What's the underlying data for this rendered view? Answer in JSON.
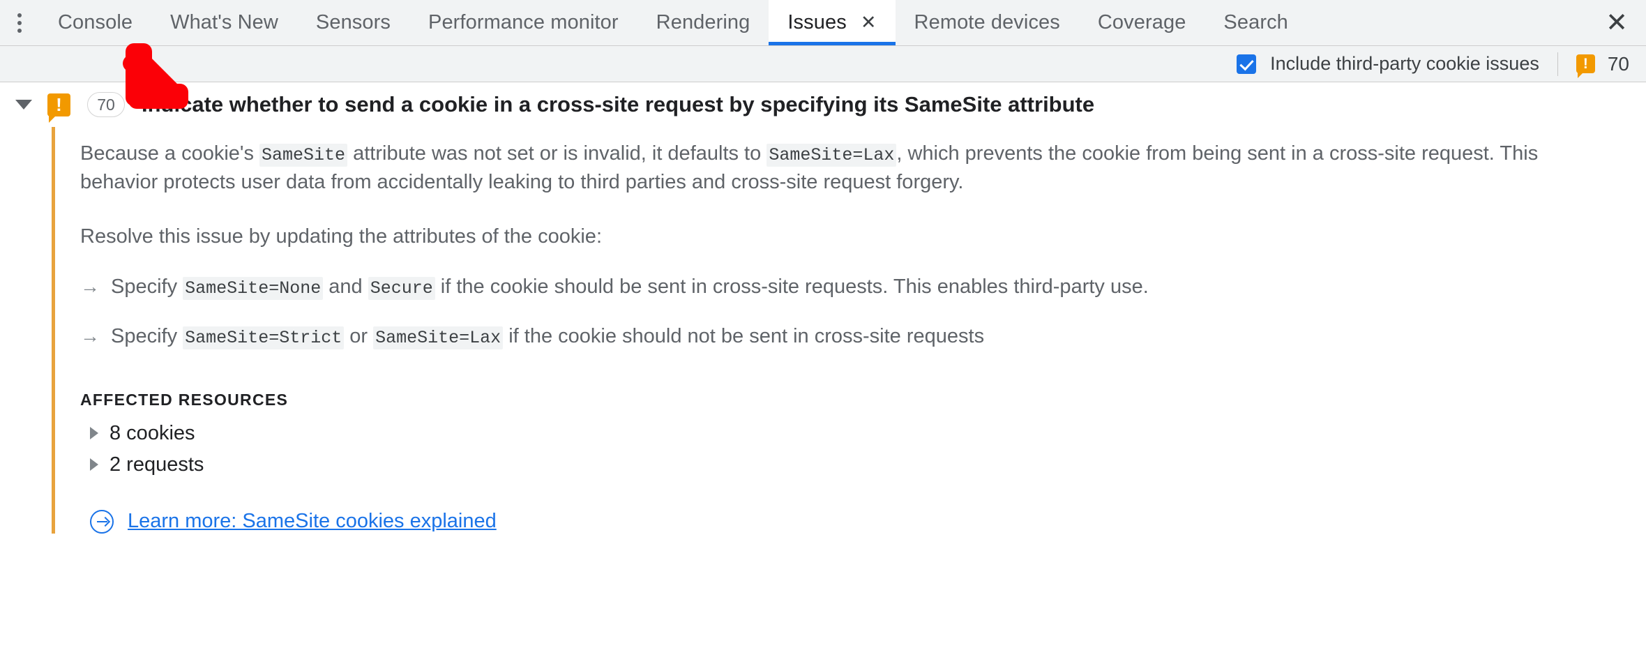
{
  "tabbar": {
    "menu_icon": "kebab-menu-icon",
    "close_icon": "close-icon",
    "close_glyph": "✕",
    "tab_close_glyph": "✕",
    "tabs": [
      {
        "label": "Console",
        "active": false
      },
      {
        "label": "What's New",
        "active": false
      },
      {
        "label": "Sensors",
        "active": false
      },
      {
        "label": "Performance monitor",
        "active": false
      },
      {
        "label": "Rendering",
        "active": false
      },
      {
        "label": "Issues",
        "active": true,
        "closable": true
      },
      {
        "label": "Remote devices",
        "active": false
      },
      {
        "label": "Coverage",
        "active": false
      },
      {
        "label": "Search",
        "active": false
      }
    ],
    "active_tab": "Issues",
    "accent_color": "#1a73e8"
  },
  "toolbar": {
    "checkbox_label": "Include third-party cookie issues",
    "checkbox_checked": true,
    "warning_icon": "warning-icon",
    "warning_count": "70",
    "warning_color": "#f29900"
  },
  "issue": {
    "expanded": true,
    "warning_icon": "warning-icon",
    "count_badge": "70",
    "title": "Indicate whether to send a cookie in a cross-site request by specifying its SameSite attribute",
    "stripe_color": "#e8a33d",
    "paragraph1": {
      "part1": "Because a cookie's ",
      "code1": "SameSite",
      "part2": " attribute was not set or is invalid, it defaults to ",
      "code2": "SameSite=Lax",
      "part3": ", which prevents the cookie from being sent in a cross-site request. This behavior protects user data from accidentally leaking to third parties and cross-site request forgery."
    },
    "paragraph2": "Resolve this issue by updating the attributes of the cookie:",
    "arrow_glyph": "→",
    "recommendations": [
      {
        "part1": "Specify ",
        "code1": "SameSite=None",
        "part2": " and ",
        "code2": "Secure",
        "part3": " if the cookie should be sent in cross-site requests. This enables third-party use."
      },
      {
        "part1": "Specify ",
        "code1": "SameSite=Strict",
        "part2": " or ",
        "code2": "SameSite=Lax",
        "part3": " if the cookie should not be sent in cross-site requests"
      }
    ],
    "affected_resources_title": "AFFECTED RESOURCES",
    "resources": [
      {
        "label": "8 cookies",
        "expanded": false
      },
      {
        "label": "2 requests",
        "expanded": false
      }
    ],
    "learn_more": {
      "icon": "circle-arrow-icon",
      "label": "Learn more: SameSite cookies explained",
      "color": "#1a73e8"
    }
  },
  "annotation": {
    "arrow_icon": "red-pointer-arrow",
    "color": "#fb0007",
    "direction": "down-left"
  }
}
